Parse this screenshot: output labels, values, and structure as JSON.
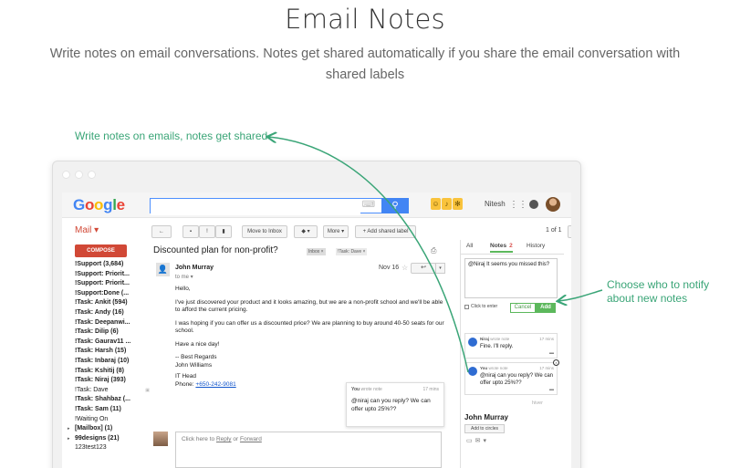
{
  "hero": {
    "title": "Email Notes",
    "subtitle": "Write notes on email conversations. Notes get shared automatically if you share the email conversation with shared labels"
  },
  "callouts": {
    "left": "Write notes on emails, notes get shared",
    "right": "Choose who to notify about new notes"
  },
  "colors": {
    "accent_green": "#3aa577",
    "gmail_red": "#d14836",
    "google_blue": "#4285f4"
  },
  "gmail": {
    "logo": [
      "G",
      "o",
      "o",
      "g",
      "l",
      "e"
    ],
    "search_placeholder": "",
    "search_icon": "search-icon",
    "user_name": "Nitesh",
    "mail_label": "Mail ▾",
    "compose_label": "COMPOSE",
    "folders": [
      {
        "twisty": "",
        "name": "!Support (3,684)",
        "bold": true
      },
      {
        "twisty": "",
        "name": "!Support: Priorit...",
        "bold": true
      },
      {
        "twisty": "",
        "name": "!Support: Priorit...",
        "bold": true
      },
      {
        "twisty": "",
        "name": "!Support:Done (...",
        "bold": true
      },
      {
        "twisty": "",
        "name": "!Task: Ankit (594)",
        "bold": true
      },
      {
        "twisty": "",
        "name": "!Task: Andy (16)",
        "bold": true
      },
      {
        "twisty": "",
        "name": "!Task: Deepanwi...",
        "bold": true
      },
      {
        "twisty": "",
        "name": "!Task: Dilip (6)",
        "bold": true
      },
      {
        "twisty": "",
        "name": "!Task: Gaurav11 ...",
        "bold": true
      },
      {
        "twisty": "",
        "name": "!Task: Harsh (15)",
        "bold": true
      },
      {
        "twisty": "",
        "name": "!Task: Inbaraj (10)",
        "bold": true
      },
      {
        "twisty": "",
        "name": "!Task: Kshitij (8)",
        "bold": true
      },
      {
        "twisty": "",
        "name": "!Task: Niraj (393)",
        "bold": true
      },
      {
        "twisty": "",
        "name": "!Task: Dave",
        "bold": false,
        "icon": true
      },
      {
        "twisty": "",
        "name": "!Task: Shahbaz (...",
        "bold": true
      },
      {
        "twisty": "",
        "name": "!Task: Sam (11)",
        "bold": true
      },
      {
        "twisty": "",
        "name": "!Waiting On",
        "bold": false
      },
      {
        "twisty": "▸",
        "name": "[Mailbox] (1)",
        "bold": true
      },
      {
        "twisty": "▸",
        "name": "99designs (21)",
        "bold": true
      },
      {
        "twisty": "",
        "name": "123test123",
        "bold": false
      }
    ],
    "toolbar": {
      "back": "←",
      "archive": "▪",
      "spam": "!",
      "trash": "▮",
      "move": "Move to Inbox",
      "labels": "◆ ▾",
      "more": "More ▾",
      "add_shared": "+ Add shared label",
      "pager": "1 of 1",
      "prev": "<",
      "next": ">",
      "settings": "⚙ ▾",
      "layout": "☷ ▾"
    },
    "thread": {
      "subject": "Discounted plan for non-profit?",
      "labels": [
        "Inbox ×",
        "!Task: Dave ×"
      ],
      "sender": "John Murray",
      "to": "to me ▾",
      "date": "Nov 16",
      "body": {
        "greeting": "Hello,",
        "p1": "I've just discovered your product and it looks amazing, but we are a non-profit school and we'll be able to afford the current pricing.",
        "p2": "I was hoping if you can offer us a discounted price? We are planning to buy around 40-50 seats for our school.",
        "p3": "Have a nice day!",
        "sig1": "-- Best Regards",
        "sig2": "John Williams",
        "sig3": "IT Head",
        "phone_label": "Phone: ",
        "phone": "+650-242-9081"
      },
      "reply_prompt": "Click here to ",
      "reply_link": "Reply",
      "reply_or": " or ",
      "forward_link": "Forward"
    },
    "floating_note": {
      "author": "You",
      "action": "wrote note",
      "time": "17 mins",
      "text": "@niraj can you reply? We can offer upto 25%??"
    },
    "notes_panel": {
      "tabs": [
        {
          "label": "All"
        },
        {
          "label": "Notes",
          "count": "2"
        },
        {
          "label": "History"
        }
      ],
      "draft": "@Niraj It seems you missed this?",
      "click_to_enter": "Click to enter",
      "cancel": "Cancel",
      "add": "Add",
      "notes": [
        {
          "author": "Niraj",
          "action": "wrote note",
          "time": "17 mins",
          "text": "Fine. I'll reply."
        },
        {
          "author": "You",
          "action": "wrote note",
          "time": "17 mins",
          "text": "@niraj can you reply? We can offer upto 25%??"
        }
      ],
      "brand": "hiver",
      "contact_name": "John Murray",
      "add_to_circles": "Add to circles"
    }
  }
}
